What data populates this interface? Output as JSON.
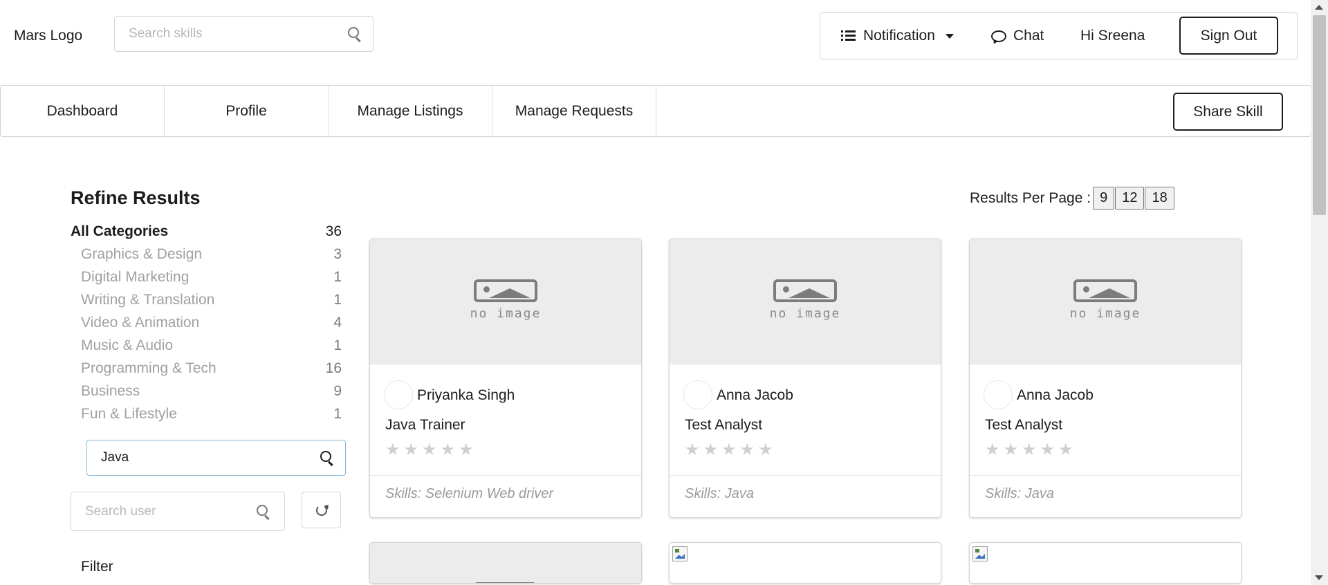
{
  "header": {
    "logo": "Mars Logo",
    "search_placeholder": "Search skills",
    "notification_label": "Notification",
    "chat_label": "Chat",
    "greeting": "Hi Sreena",
    "signout_label": "Sign Out"
  },
  "nav": {
    "items": [
      {
        "label": "Dashboard"
      },
      {
        "label": "Profile"
      },
      {
        "label": "Manage Listings"
      },
      {
        "label": "Manage Requests"
      }
    ],
    "share_label": "Share Skill"
  },
  "sidebar": {
    "title": "Refine Results",
    "categories": [
      {
        "label": "All Categories",
        "count": "36"
      },
      {
        "label": "Graphics & Design",
        "count": "3"
      },
      {
        "label": "Digital Marketing",
        "count": "1"
      },
      {
        "label": "Writing & Translation",
        "count": "1"
      },
      {
        "label": "Video & Animation",
        "count": "4"
      },
      {
        "label": "Music & Audio",
        "count": "1"
      },
      {
        "label": "Programming & Tech",
        "count": "16"
      },
      {
        "label": "Business",
        "count": "9"
      },
      {
        "label": "Fun & Lifestyle",
        "count": "1"
      }
    ],
    "skill_search_value": "Java",
    "user_search_placeholder": "Search user",
    "filter_label": "Filter"
  },
  "results": {
    "per_page_label": "Results Per Page :",
    "per_page_options": [
      "9",
      "12",
      "18"
    ],
    "no_image_text": "no image",
    "star_glyph": "★",
    "cards": [
      {
        "author": "Priyanka Singh",
        "title": "Java Trainer",
        "skills": "Skills: Selenium Web driver"
      },
      {
        "author": "Anna Jacob",
        "title": "Test Analyst",
        "skills": "Skills: Java"
      },
      {
        "author": "Anna Jacob",
        "title": "Test Analyst",
        "skills": "Skills: Java"
      }
    ]
  }
}
